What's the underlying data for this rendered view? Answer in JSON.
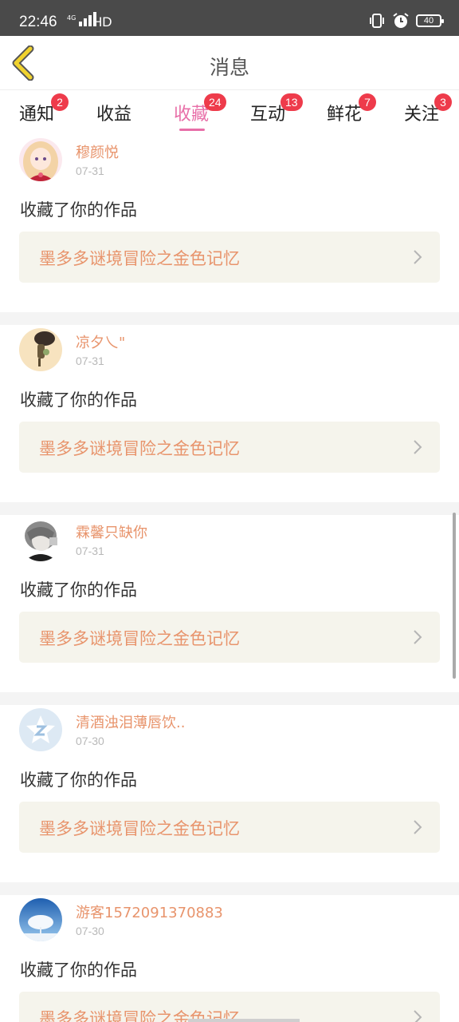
{
  "status_bar": {
    "time": "22:46",
    "network": "4G",
    "hd": "HD",
    "battery": "40"
  },
  "header": {
    "title": "消息"
  },
  "tabs": [
    {
      "label": "通知",
      "badge": "2"
    },
    {
      "label": "收益",
      "badge": ""
    },
    {
      "label": "收藏",
      "badge": "24",
      "active": true
    },
    {
      "label": "互动",
      "badge": "13"
    },
    {
      "label": "鲜花",
      "badge": "7"
    },
    {
      "label": "关注",
      "badge": "3"
    }
  ],
  "colors": {
    "accent": "#e86fa8",
    "username": "#e8946c",
    "badge": "#ee3b4b",
    "back_arrow": "#f0d22e"
  },
  "items": [
    {
      "username": "穆颜悦",
      "date": "07-31",
      "action": "收藏了你的作品",
      "work_title": "墨多多谜境冒险之金色记忆",
      "avatar": "anime-girl-avatar"
    },
    {
      "username": "凉夕乀\"",
      "date": "07-31",
      "action": "收藏了你的作品",
      "work_title": "墨多多谜境冒险之金色记忆",
      "avatar": "figure-avatar"
    },
    {
      "username": "霖馨只缺你",
      "date": "07-31",
      "action": "收藏了你的作品",
      "work_title": "墨多多谜境冒险之金色记忆",
      "avatar": "gray-hair-avatar"
    },
    {
      "username": "清酒浊泪薄唇饮..",
      "date": "07-30",
      "action": "收藏了你的作品",
      "work_title": "墨多多谜境冒险之金色记忆",
      "avatar": "default-z-avatar"
    },
    {
      "username": "游客1572091370883",
      "date": "07-30",
      "action": "收藏了你的作品",
      "work_title": "墨多多谜境冒险之金色记忆",
      "avatar": "snow-tree-avatar"
    }
  ]
}
